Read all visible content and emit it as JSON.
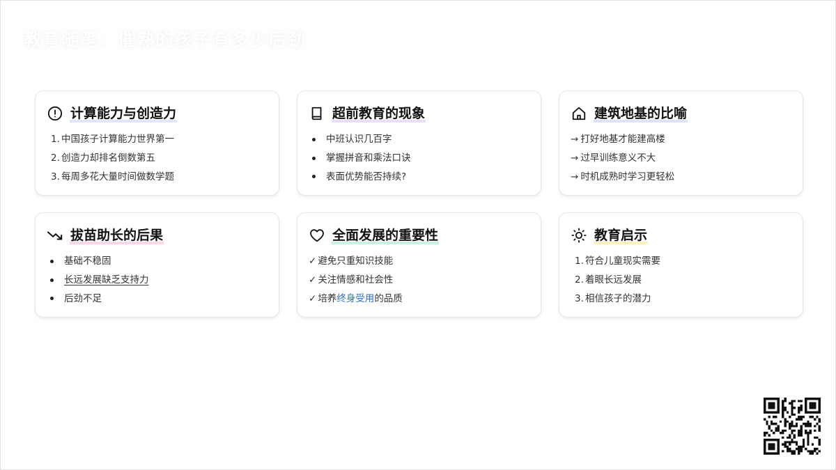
{
  "page": {
    "title": "教育随笔：催熟的孩子有多少后劲"
  },
  "cards": [
    {
      "icon": "alert-circle-icon",
      "title": "计算能力与创造力",
      "items": [
        {
          "marker": "1.",
          "text": "中国孩子计算能力世界第一"
        },
        {
          "marker": "2.",
          "text": "创造力却排名倒数第五"
        },
        {
          "marker": "3.",
          "text": "每周多花大量时间做数学题"
        }
      ]
    },
    {
      "icon": "book-icon",
      "title": "超前教育的现象",
      "items": [
        {
          "text": "中班认识几百字"
        },
        {
          "text": "掌握拼音和乘法口诀"
        },
        {
          "text": "表面优势能否持续?"
        }
      ]
    },
    {
      "icon": "home-icon",
      "title": "建筑地基的比喻",
      "items": [
        {
          "marker": "→",
          "text": "打好地基才能建高楼"
        },
        {
          "marker": "→",
          "text": "过早训练意义不大"
        },
        {
          "marker": "→",
          "text": "时机成熟时学习更轻松"
        }
      ]
    },
    {
      "icon": "trending-down-icon",
      "title": "拔苗助长的后果",
      "items": [
        {
          "text": "基础不稳固"
        },
        {
          "text": "长远发展缺乏支持力"
        },
        {
          "text": "后劲不足"
        }
      ]
    },
    {
      "icon": "heart-icon",
      "title": "全面发展的重要性",
      "items": [
        {
          "marker": "✓",
          "text": "避免只重知识技能"
        },
        {
          "marker": "✓",
          "text": "关注情感和社会性"
        },
        {
          "marker": "✓",
          "pre": "培养",
          "highlight": "终身受用",
          "post": "的品质"
        }
      ]
    },
    {
      "icon": "sun-icon",
      "title": "教育启示",
      "items": [
        {
          "marker": "1.",
          "text": "符合儿童现实需要"
        },
        {
          "marker": "2.",
          "text": "着眼长远发展"
        },
        {
          "marker": "3.",
          "text": "相信孩子的潜力"
        }
      ]
    }
  ],
  "colors": {
    "accent_link": "#2b6fd6",
    "card_border": "#e6e6e6",
    "title_underlines": [
      "#dfe6ff",
      "#ecdcff",
      "#dde3ff",
      "#ffd6ea",
      "#c9f2e6",
      "#fff1b8"
    ]
  },
  "qr_icon": "qr-code-icon"
}
